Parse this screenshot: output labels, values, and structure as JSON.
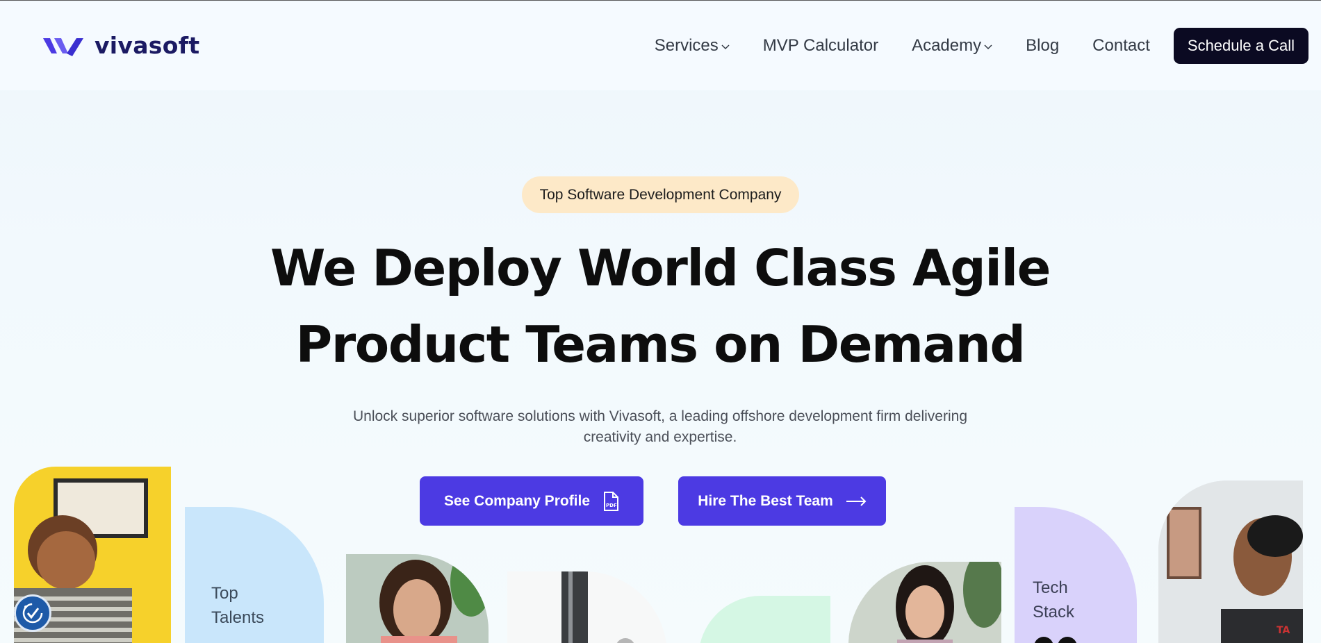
{
  "header": {
    "logo_text": "vivasoft",
    "nav": [
      {
        "label": "Services",
        "has_dropdown": true
      },
      {
        "label": "MVP Calculator",
        "has_dropdown": false
      },
      {
        "label": "Academy",
        "has_dropdown": true
      },
      {
        "label": "Blog",
        "has_dropdown": false
      },
      {
        "label": "Contact",
        "has_dropdown": false
      }
    ],
    "cta_label": "Schedule a Call"
  },
  "hero": {
    "badge": "Top Software Development Company",
    "headline_line1": "We Deploy World Class Agile",
    "headline_line2": "Product Teams on Demand",
    "subtitle_line1": "Unlock superior software solutions with Vivasoft, a leading offshore development firm delivering",
    "subtitle_line2": "creativity and expertise.",
    "btn_profile": "See Company Profile",
    "btn_hire": "Hire The Best Team"
  },
  "collage": {
    "card1_line1": "Top",
    "card1_line2": "Talents",
    "card2_line1": "Tech",
    "card2_line2": "Stack"
  },
  "icons": {
    "pdf": "pdf-icon",
    "arrow": "arrow-right-icon",
    "accessibility": "accessibility-icon"
  },
  "colors": {
    "brand_purple": "#4c3ae3",
    "logo_navy": "#1b1a63",
    "cta_dark": "#0b0a22",
    "badge_bg": "#fde9c8"
  }
}
